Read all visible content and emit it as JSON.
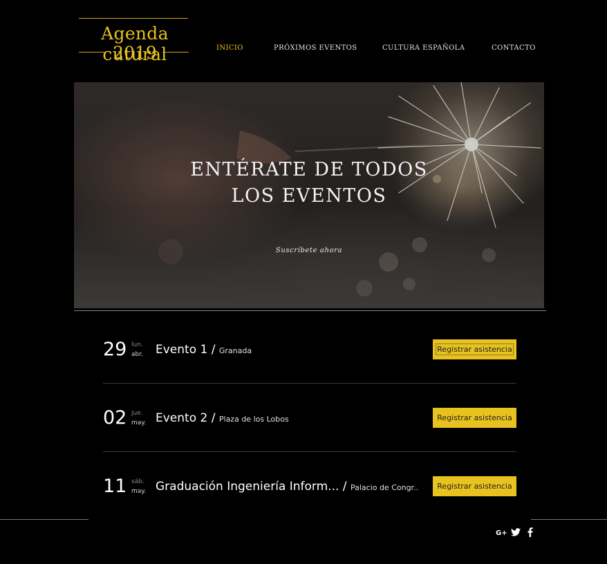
{
  "logo": {
    "line1": "Agenda cutural",
    "line2": "2019"
  },
  "nav": {
    "items": [
      {
        "label": "INICIO",
        "active": true
      },
      {
        "label": "PRÓXIMOS EVENTOS",
        "active": false
      },
      {
        "label": "CULTURA ESPAÑOLA",
        "active": false
      },
      {
        "label": "CONTACTO",
        "active": false
      }
    ]
  },
  "hero": {
    "title_line1": "ENTÉRATE DE TODOS",
    "title_line2": "LOS EVENTOS",
    "cta": "Suscríbete ahora"
  },
  "events": [
    {
      "day": "29",
      "weekday": "lun.",
      "month": "abr.",
      "title": "Evento 1",
      "separator": " / ",
      "place": "Granada",
      "button": "Registrar asistencia"
    },
    {
      "day": "02",
      "weekday": "jue.",
      "month": "may.",
      "title": "Evento 2",
      "separator": " / ",
      "place": "Plaza de los Lobos",
      "button": "Registrar asistencia"
    },
    {
      "day": "11",
      "weekday": "sáb.",
      "month": "may.",
      "title": "Graduación Ingeniería Inform...",
      "separator": " / ",
      "place": "Palacio de Congr...",
      "button": "Registrar asistencia"
    }
  ],
  "social": {
    "icons": [
      "google-plus-icon",
      "twitter-icon",
      "facebook-icon"
    ]
  },
  "colors": {
    "accent": "#e8c21e",
    "background": "#000000",
    "button_text": "#1e1e1e"
  }
}
